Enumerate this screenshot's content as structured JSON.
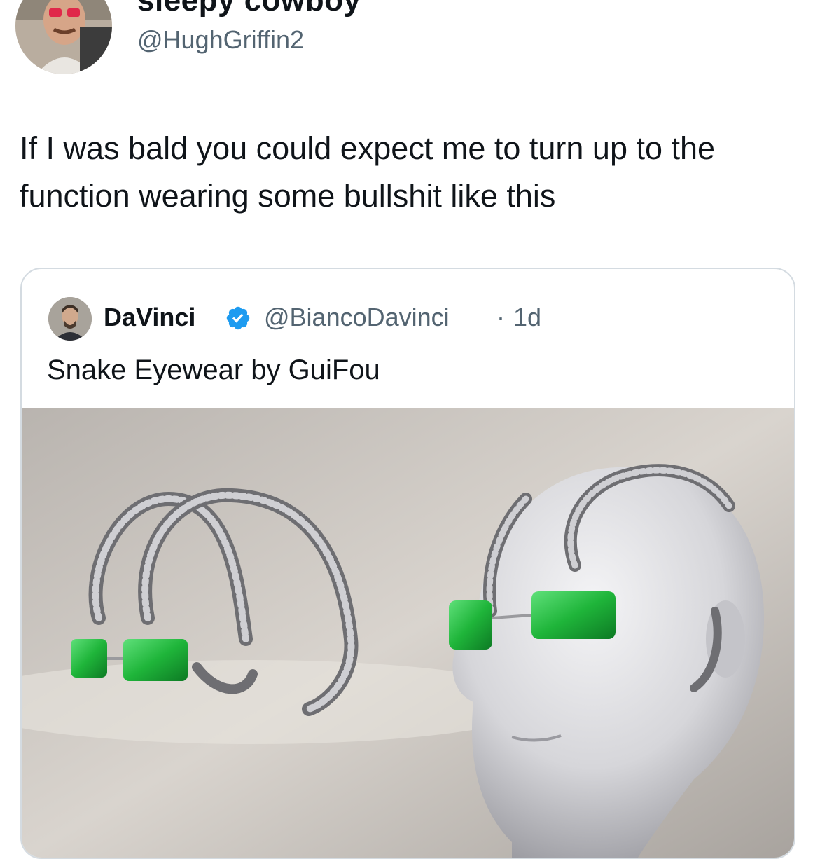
{
  "author": {
    "display_name": "sleepy cowboy",
    "handle": "@HughGriffin2"
  },
  "tweet": {
    "text": "If I was bald you could expect me to turn up to the function wearing some bullshit like this"
  },
  "quoted_tweet": {
    "display_name": "DaVinci",
    "handle": "@BiancoDavinci",
    "separator": "·",
    "time": "1d",
    "text": "Snake Eyewear by GuiFou"
  },
  "colors": {
    "text_primary": "#0f1419",
    "text_secondary": "#536471",
    "verified_blue": "#1d9bf0",
    "card_border": "#d4dbe1",
    "lens_green": "#1fb53a"
  },
  "icons": [
    "verified-badge-icon"
  ]
}
